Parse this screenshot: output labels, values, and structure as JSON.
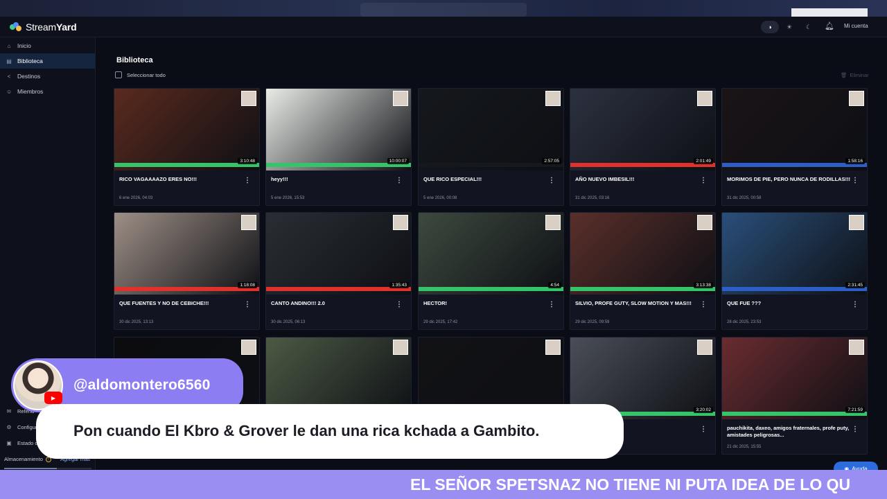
{
  "app": {
    "name_prefix": "Stream",
    "name_suffix": "Yard",
    "account_label": "Mi cuenta"
  },
  "theme_icons": [
    "contrast-icon",
    "sun-icon",
    "moon-icon"
  ],
  "sidebar": {
    "items": [
      {
        "label": "Inicio",
        "icon": "home-icon"
      },
      {
        "label": "Biblioteca",
        "icon": "library-icon",
        "active": true
      },
      {
        "label": "Destinos",
        "icon": "share-icon"
      },
      {
        "label": "Miembros",
        "icon": "people-icon"
      }
    ],
    "bottom_items": [
      {
        "label": "Referid",
        "icon": "gift-icon"
      },
      {
        "label": "Configur",
        "icon": "gear-icon"
      },
      {
        "label": "Estado de",
        "icon": "status-icon"
      }
    ],
    "storage_label": "Almacenamiento",
    "storage_add": "Agregar más"
  },
  "library": {
    "title": "Biblioteca",
    "select_all": "Seleccionar todo",
    "delete_label": "Eliminar"
  },
  "videos": [
    {
      "title": "RICO VAGAAAAZO ERES NO!!!",
      "date": "6 ene 2026, 04:03",
      "duration": "3:10:48",
      "bg": "#5a2a1e",
      "accent": "#35c46a"
    },
    {
      "title": "heyy!!!",
      "date": "5 ene 2026, 15:53",
      "duration": "10:00:07",
      "bg": "#e8ebe6",
      "accent": "#35c46a"
    },
    {
      "title": "QUE RICO ESPECIAL!!!",
      "date": "5 ene 2026, 00:08",
      "duration": "2:57:05",
      "bg": "#15181c",
      "accent": "#15181c"
    },
    {
      "title": "AÑO NUEVO IMBESIL!!!",
      "date": "31 dic 2025, 03:16",
      "duration": "2:01:49",
      "bg": "#2c3140",
      "accent": "#e0312d"
    },
    {
      "title": "MORIMOS DE PIE, PERO NUNCA DE RODILLAS!!!",
      "date": "31 dic 2025, 00:58",
      "duration": "1:58:16",
      "bg": "#1a1416",
      "accent": "#2d5ec8"
    },
    {
      "title": "QUE FUENTES Y NO DE CEBICHE!!!",
      "date": "30 dic 2025, 13:13",
      "duration": "1:18:08",
      "bg": "#9e8f86",
      "accent": "#e0312d"
    },
    {
      "title": "CANTO ANDINO!!! 2.0",
      "date": "30 dic 2025, 06:13",
      "duration": "1:35:43",
      "bg": "#2a2e34",
      "accent": "#e0312d"
    },
    {
      "title": "HECTOR!",
      "date": "29 dic 2025, 17:42",
      "duration": "4:54",
      "bg": "#3d4a3f",
      "accent": "#35c46a"
    },
    {
      "title": "SILVIO, PROFE GUTY, SLOW MOTION Y MAS!!!",
      "date": "29 dic 2025, 09:59",
      "duration": "3:13:38",
      "bg": "#5a2f2a",
      "accent": "#35c46a"
    },
    {
      "title": "QUE FUE ???",
      "date": "28 dic 2025, 23:53",
      "duration": "2:31:45",
      "bg": "#2a4f7a",
      "accent": "#2d5ec8"
    },
    {
      "title": "",
      "date": "",
      "duration": "",
      "bg": "#0c0c0e",
      "accent": "#0c0c0e"
    },
    {
      "title": "",
      "date": "",
      "duration": "",
      "bg": "#4c5a44",
      "accent": "#35c46a"
    },
    {
      "title": "",
      "date": "",
      "duration": "",
      "bg": "#121214",
      "accent": "#121214"
    },
    {
      "title": "",
      "date": "",
      "duration": "3:20:02",
      "bg": "#4a4e57",
      "accent": "#35c46a"
    },
    {
      "title": "pauchikita, daxeo, amigos fraternales, profe puty, amistades peligrosas...",
      "date": "21 dic 2025, 15:55",
      "duration": "7:21:59",
      "bg": "#6a2c30",
      "accent": "#35c46a"
    }
  ],
  "overlay": {
    "username": "@aldomontero6560",
    "comment": "Pon cuando El Kbro & Grover le dan una rica kchada a Gambito."
  },
  "help_label": "Ayuda",
  "ticker": "EL SEÑOR SPETSNAZ NO TIENE NI PUTA IDEA DE LO QU"
}
